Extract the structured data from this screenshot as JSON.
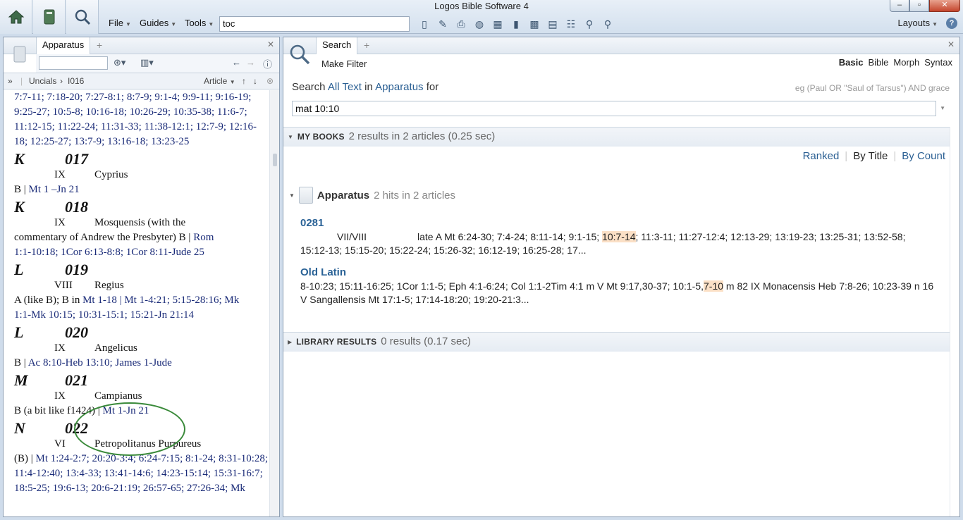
{
  "app": {
    "title": "Logos Bible Software 4"
  },
  "window": {
    "minimize": "–",
    "maximize": "▫",
    "close": "✕"
  },
  "toolbar": {
    "menus": [
      "File",
      "Guides",
      "Tools"
    ],
    "command_value": "toc",
    "layouts": "Layouts",
    "help": "?"
  },
  "left_panel": {
    "tab": "Apparatus",
    "breadcrumb": {
      "expand": "»",
      "items": [
        "Uncials",
        "I016"
      ],
      "sep": "›",
      "section": "Article"
    },
    "entries": [
      {
        "type": "refs",
        "text": "7:7-11; 7:18-20; 7:27-8:1; 8:7-9; 9:1-4; 9:9-11; 9:16-19; 9:25-27; 10:5-8; 10:16-18; 10:26-29; 10:35-38; 11:6-7; 11:12-15; 11:22-24; 11:31-33; 11:38-12:1; 12:7-9; 12:16-18; 12:25-27; 13:7-9; 13:16-18; 13:23-25"
      },
      {
        "type": "sig",
        "letter": "K",
        "num": "017"
      },
      {
        "type": "meta",
        "century": "IX",
        "name": "Cyprius"
      },
      {
        "type": "text",
        "plain": "B |",
        "refs": "Mt 1 –Jn 21"
      },
      {
        "type": "sig",
        "letter": "K",
        "num": "018"
      },
      {
        "type": "meta",
        "century": "IX",
        "name": "Mosquensis (with the"
      },
      {
        "type": "text",
        "plain": "commentary of Andrew the Presbyter)      B |",
        "refs": "Rom"
      },
      {
        "type": "text",
        "plain": "",
        "refs": "1:1-10:18; 1Cor 6:13-8:8; 1Cor 8:11-Jude 25"
      },
      {
        "type": "sig",
        "letter": "L",
        "num": "019"
      },
      {
        "type": "meta",
        "century": "VIII",
        "name": "Regius"
      },
      {
        "type": "text",
        "plain": "A (like B); B in",
        "refs": "Mt 1-18 | Mt 1-4:21; 5:15-28:16; Mk"
      },
      {
        "type": "text",
        "plain": "",
        "refs": "1:1-Mk 10:15; 10:31-15:1; 15:21-Jn 21:14"
      },
      {
        "type": "sig",
        "letter": "L",
        "num": "020"
      },
      {
        "type": "meta",
        "century": "IX",
        "name": "Angelicus"
      },
      {
        "type": "text",
        "plain": "B |",
        "refs": "Ac 8:10-Heb 13:10; James 1-Jude"
      },
      {
        "type": "sig",
        "letter": "M",
        "num": "021"
      },
      {
        "type": "meta",
        "century": "IX",
        "name": "Campianus"
      },
      {
        "type": "text",
        "plain": "B (a bit like f1424) |",
        "refs": "Mt 1-Jn 21"
      },
      {
        "type": "sig",
        "letter": "N",
        "num": "022"
      },
      {
        "type": "meta",
        "century": "VI",
        "name": "Petropolitanus  Purpureus"
      },
      {
        "type": "text",
        "plain": "(B) |",
        "refs": "Mt 1:24-2:7; 20:20-3:4; 6:24-7:15; 8:1-24; 8:31-10:28; 11:4-12:40; 13:4-33; 13:41-14:6; 14:23-15:14; 15:31-16:7; 18:5-25; 19:6-13; 20:6-21:19; 26:57-65; 27:26-34; Mk"
      }
    ]
  },
  "search_panel": {
    "tab": "Search",
    "make_filter": "Make Filter",
    "modes": [
      "Basic",
      "Bible",
      "Morph",
      "Syntax"
    ],
    "search_label": "Search",
    "scope_text": "All Text",
    "in_word": "in",
    "scope_book": "Apparatus",
    "for_word": "for",
    "hint_prefix": "eg",
    "hint": "(Paul OR \"Saul of Tarsus\") AND grace",
    "query": "mat 10:10",
    "my_books": {
      "label": "MY BOOKS",
      "summary": "2 results in 2 articles (0.25 sec)"
    },
    "sort": [
      "Ranked",
      "By Title",
      "By Count"
    ],
    "book": {
      "name": "Apparatus",
      "hits": "2 hits in 2 articles"
    },
    "results": [
      {
        "title": "0281",
        "line1_century": "VII/VIII",
        "line1_pre": "late A Mt 6:24-30; 7:4-24; 8:11-14; 9:1-15;",
        "hl": "10:7-14",
        "line1_post": "; 11:3-11; 11:27-12:4; 12:13-29; 13:19-23; 13:25-31; 13:52-58;",
        "line2": "15:12-13; 15:15-20; 15:22-24; 15:26-32; 16:12-19; 16:25-28; 17..."
      },
      {
        "title": "Old Latin",
        "line1_pre": "8-10:23; 15:11-16:25; 1Cor 1:1-5; Eph 4:1-6:24; Col 1:1-2Tim 4:1 m V Mt 9:17,30-37; 10:1-5,",
        "hl": "7-10",
        "line1_post": " m 82 IX Monacensis Heb 7:8-26; 10:23-39 n 16",
        "line2": "V Sangallensis Mt 17:1-5; 17:14-18:20; 19:20-21:3..."
      }
    ],
    "library": {
      "label": "LIBRARY RESULTS",
      "summary": "0 results (0.17 sec)"
    }
  }
}
